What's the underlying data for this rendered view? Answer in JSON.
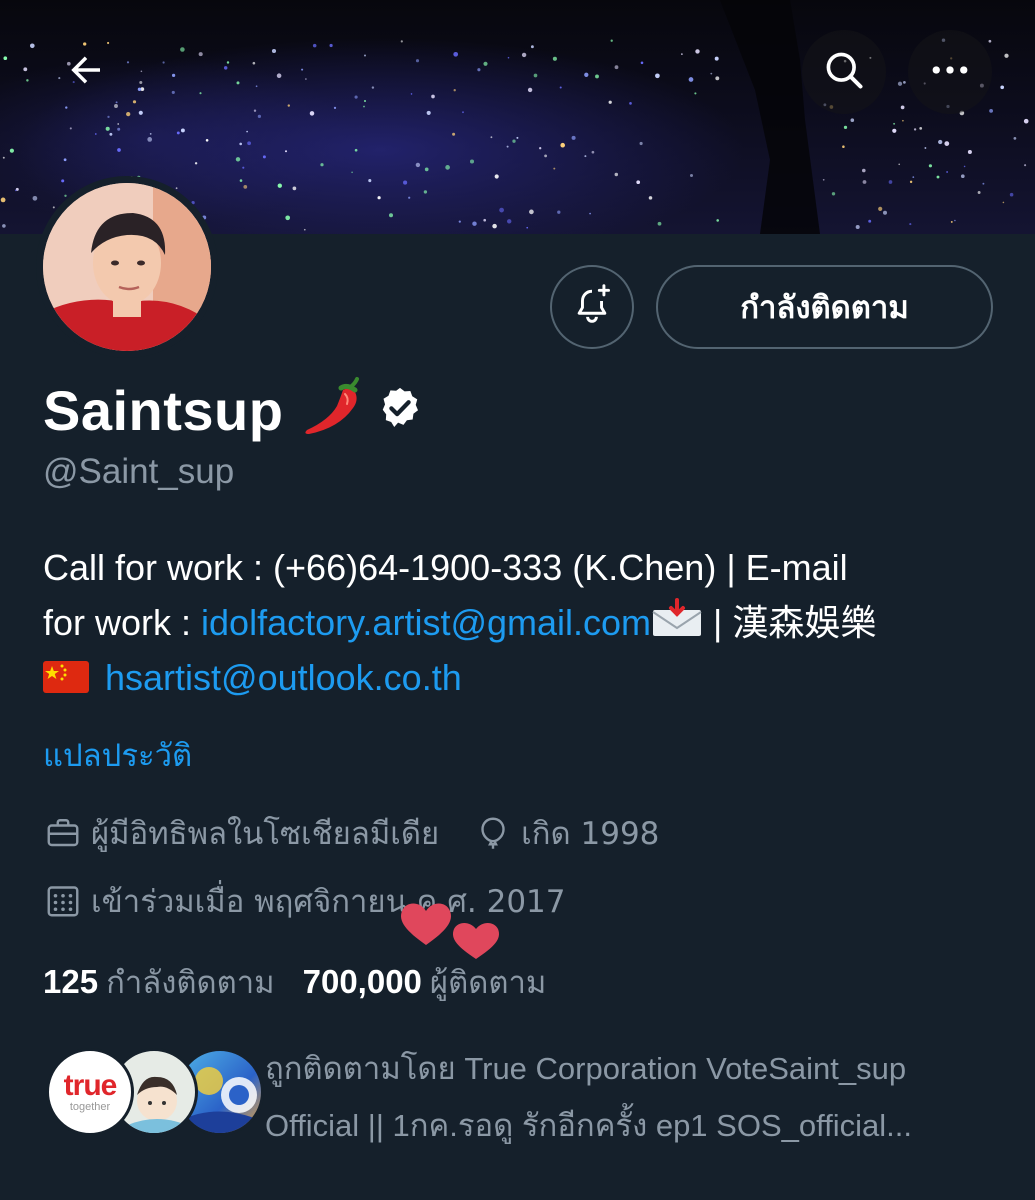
{
  "header": {
    "back_icon": "arrow-left-icon",
    "search_icon": "search-icon",
    "more_icon": "more-horizontal-icon"
  },
  "profile": {
    "display_name": "Saintsup",
    "name_emoji": "chili-pepper",
    "verified": true,
    "handle": "@Saint_sup"
  },
  "actions": {
    "notify_icon": "bell-plus-icon",
    "follow_label": "กำลังติดตาม"
  },
  "bio": {
    "line1": "Call for work : (+66)64-1900-333 (K.Chen) | E-mail",
    "line2_prefix": "for work : ",
    "email1": "idolfactory.artist@gmail.com",
    "line2_suffix": " | 漢森娛樂",
    "email2": "hsartist@outlook.co.th"
  },
  "translate_label": "แปลประวัติ",
  "meta": {
    "category": "ผู้มีอิทธิพลในโซเชียลมีเดีย",
    "birth": "เกิด 1998",
    "joined": "เข้าร่วมเมื่อ พฤศจิกายน ค.ศ. 2017"
  },
  "stats": {
    "following_count": "125",
    "following_label": "กำลังติดตาม",
    "followers_count": "700,000",
    "followers_label": "ผู้ติดตาม"
  },
  "followed_by": {
    "line1": "ถูกติดตามโดย True Corporation VoteSaint_sup",
    "line2": "Official || 1กค.รอดู รักอีกครั้ง ep1 SOS_official...",
    "avatar1_text": "true",
    "avatar1_sub": "together"
  },
  "colors": {
    "background": "#15202b",
    "link": "#1d9bf0",
    "muted": "#8b98a5",
    "border": "#536471"
  }
}
